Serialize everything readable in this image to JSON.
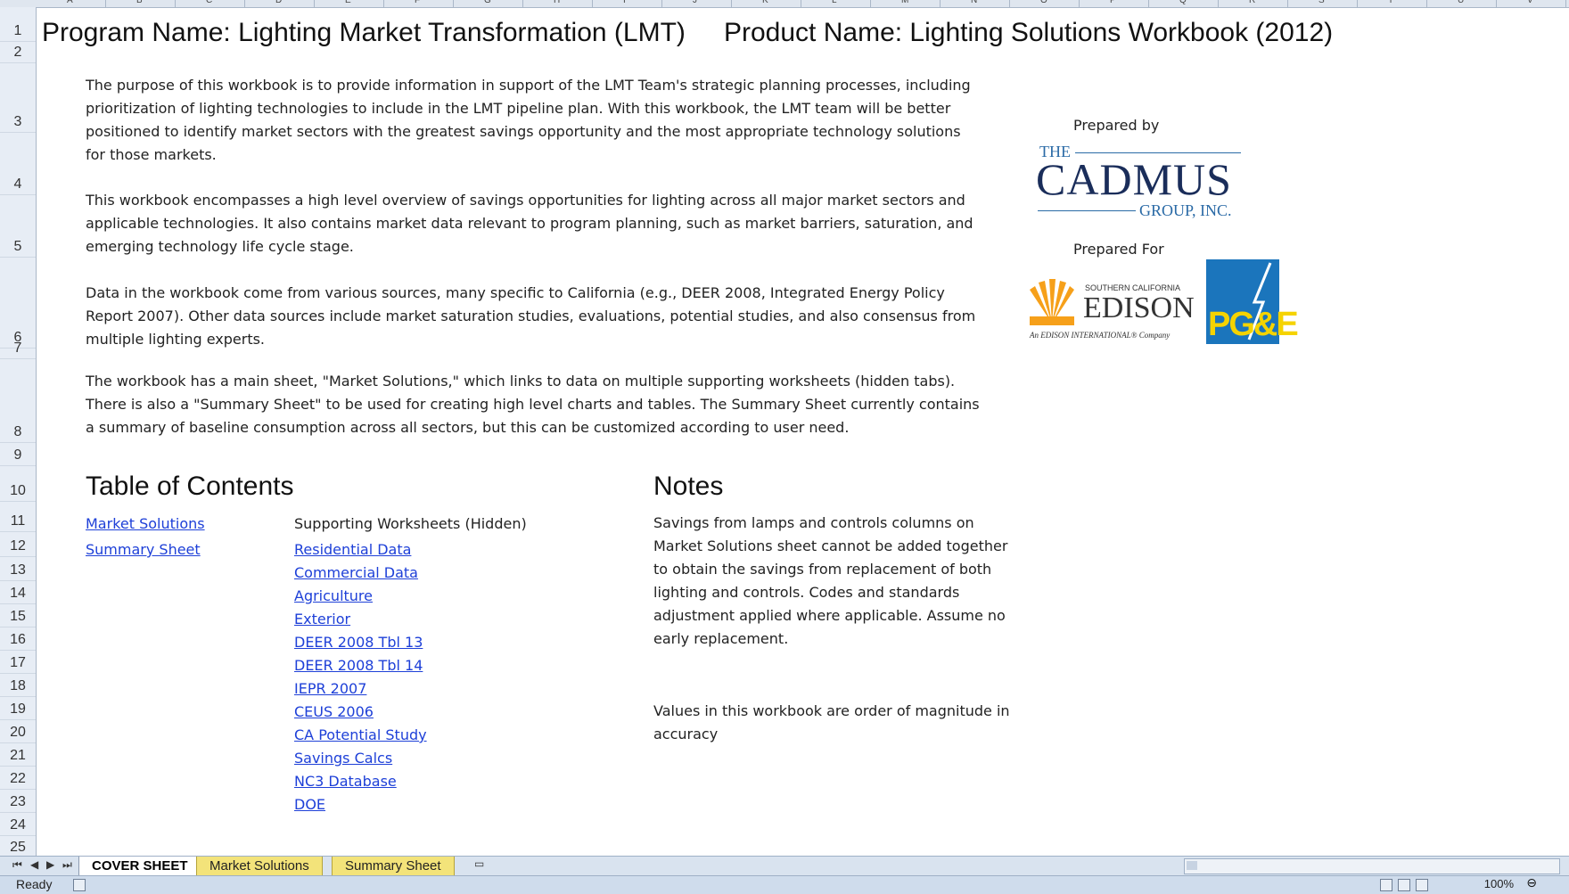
{
  "columns": [
    "A",
    "B",
    "C",
    "D",
    "E",
    "F",
    "G",
    "H",
    "I",
    "J",
    "K",
    "L",
    "M",
    "N",
    "O",
    "P",
    "Q",
    "R",
    "S",
    "T",
    "U",
    "V"
  ],
  "rows": [
    "1",
    "2",
    "3",
    "4",
    "5",
    "6",
    "7",
    "8",
    "9",
    "10",
    "11",
    "12",
    "13",
    "14",
    "15",
    "16",
    "17",
    "18",
    "19",
    "20",
    "21",
    "22",
    "23",
    "24",
    "25"
  ],
  "header": {
    "program_name": "Program Name: Lighting Market Transformation (LMT)",
    "product_name": "Product Name: Lighting Solutions Workbook (2012)"
  },
  "intro": {
    "paragraphs": [
      "The purpose of this workbook is to provide information in support of the LMT Team's strategic planning processes, including prioritization of lighting technologies to include in the LMT pipeline plan. With this workbook, the LMT team will be better positioned to identify market sectors with the greatest savings opportunity and the most appropriate technology solutions for those markets.",
      "This workbook encompasses a high level overview of savings opportunities for lighting across all major market sectors and applicable technologies. It also contains market data relevant to program planning, such as market barriers, saturation, and emerging technology life cycle stage.",
      "Data in the workbook come from various sources, many specific to California (e.g., DEER 2008, Integrated Energy Policy Report 2007). Other data sources include market saturation studies, evaluations, potential studies, and also consensus from multiple lighting experts.",
      "The workbook has a main sheet, \"Market Solutions,\" which links to data on multiple supporting worksheets (hidden tabs). There is also a \"Summary Sheet\" to be used for creating high level charts and tables. The Summary Sheet currently contains a summary of baseline consumption across all sectors, but this can be customized according to user need."
    ]
  },
  "prepared": {
    "prepared_by": "Prepared by",
    "prepared_for": "Prepared For",
    "cadmus_the": "THE",
    "cadmus_name": "CADMUS",
    "cadmus_group": "GROUP, INC.",
    "sce_line1": "SOUTHERN CALIFORNIA",
    "sce_name": "EDISON",
    "sce_tag": "An EDISON INTERNATIONAL® Company",
    "pge": "PG&E"
  },
  "toc": {
    "title": "Table of Contents",
    "main_links": [
      "Market Solutions",
      "Summary Sheet"
    ],
    "supporting_title": "Supporting Worksheets (Hidden)",
    "supporting_links": [
      "Residential Data",
      "Commercial Data",
      "Agriculture",
      "Exterior",
      "DEER 2008 Tbl 13",
      "DEER 2008 Tbl 14",
      "IEPR 2007",
      "CEUS 2006",
      "CA Potential Study",
      "Savings Calcs",
      "NC3 Database",
      "DOE"
    ]
  },
  "notes": {
    "title": "Notes",
    "note1": "Savings from lamps and controls columns on Market Solutions sheet cannot be added together to obtain the savings from replacement of both lighting and controls. Codes and standards adjustment applied where applicable. Assume no early replacement.",
    "note2": "Values in this workbook are order of magnitude in accuracy"
  },
  "tabs": {
    "items": [
      "COVER SHEET",
      "Market Solutions",
      "Summary Sheet"
    ],
    "active": "COVER SHEET"
  },
  "status": {
    "ready": "Ready",
    "zoom": "100%"
  },
  "colors": {
    "link": "#1e40d8",
    "tab_inactive": "#f3e37a",
    "cadmus_navy": "#1a2d5a",
    "cadmus_blue": "#2a6aa6",
    "pge_blue": "#1b75bc",
    "sce_orange": "#f6a01a"
  }
}
